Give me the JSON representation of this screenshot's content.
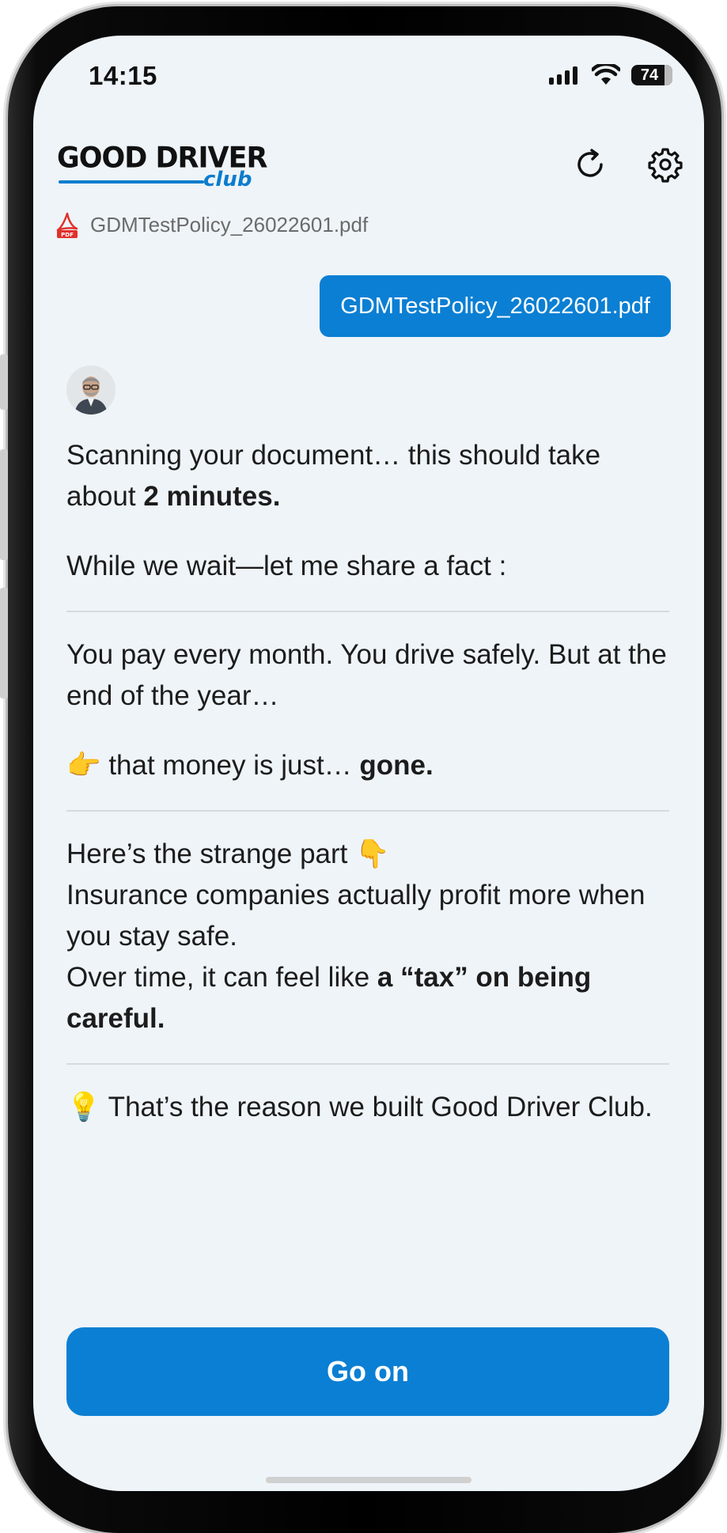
{
  "status_bar": {
    "time": "14:15",
    "battery": "74"
  },
  "header": {
    "logo_main": "GOOD DRIVER",
    "logo_sub": "club"
  },
  "attachment": {
    "file_name": "GDMTestPolicy_26022601.pdf",
    "pdf_badge": "PDF"
  },
  "user_message": "GDMTestPolicy_26022601.pdf",
  "assistant": {
    "p1_text": "Scanning your document… this should take about ",
    "p1_bold": "2 minutes.",
    "p2": "While we wait—let me share a fact :",
    "p3": "You pay every month. You drive safely. But at the end of the year…",
    "p4_emoji": "👉",
    "p4_text": " that money is just… ",
    "p4_bold": "gone.",
    "p5_line1": "Here’s the strange part ",
    "p5_emoji": "👇",
    "p5_line2": "Insurance companies actually profit more when you stay safe.",
    "p5_line3_text": "Over time, it can feel like ",
    "p5_line3_bold": "a “tax” on being careful.",
    "p6_emoji": "💡",
    "p6_text": " That’s the reason we built Good Driver Club."
  },
  "actions": {
    "go_on_label": "Go on"
  },
  "colors": {
    "accent": "#0b7fd3",
    "background": "#eef4f8",
    "text": "#1c1c1c"
  }
}
